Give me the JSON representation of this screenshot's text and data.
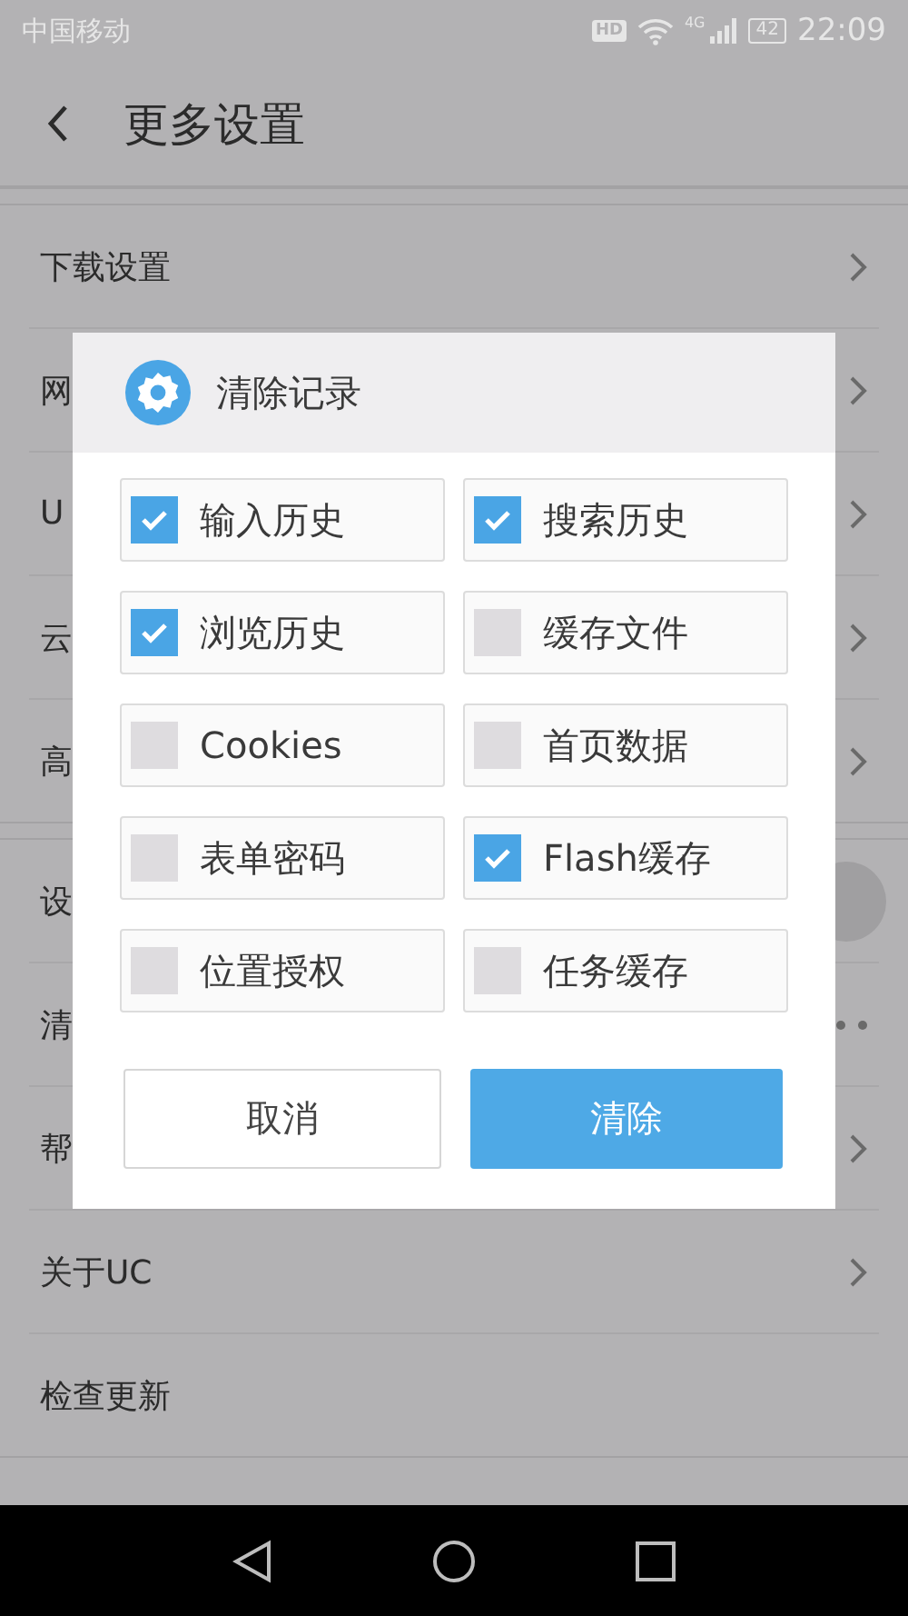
{
  "status_bar": {
    "carrier": "中国移动",
    "hd_badge": "HD",
    "network": "4G",
    "battery": "42",
    "time": "22:09"
  },
  "header": {
    "title": "更多设置"
  },
  "settings_groups": [
    {
      "rows": [
        {
          "label": "下载设置",
          "kind": "link"
        },
        {
          "label": "网",
          "kind": "link"
        },
        {
          "label": "U",
          "kind": "link"
        },
        {
          "label": "云",
          "kind": "link"
        },
        {
          "label": "高",
          "kind": "link"
        }
      ]
    },
    {
      "rows": [
        {
          "label": "设",
          "kind": "switch"
        },
        {
          "label": "清",
          "kind": "more"
        },
        {
          "label": "帮",
          "kind": "link"
        },
        {
          "label": "关于UC",
          "kind": "link"
        },
        {
          "label": "检查更新",
          "kind": "plain"
        }
      ]
    }
  ],
  "dialog": {
    "title": "清除记录",
    "options": [
      {
        "label": "输入历史",
        "checked": true
      },
      {
        "label": "搜索历史",
        "checked": true
      },
      {
        "label": "浏览历史",
        "checked": true
      },
      {
        "label": "缓存文件",
        "checked": false
      },
      {
        "label": "Cookies",
        "checked": false
      },
      {
        "label": "首页数据",
        "checked": false
      },
      {
        "label": "表单密码",
        "checked": false
      },
      {
        "label": "Flash缓存",
        "checked": true
      },
      {
        "label": "位置授权",
        "checked": false
      },
      {
        "label": "任务缓存",
        "checked": false
      }
    ],
    "buttons": [
      {
        "label": "取消",
        "kind": "secondary"
      },
      {
        "label": "清除",
        "kind": "primary"
      }
    ]
  }
}
